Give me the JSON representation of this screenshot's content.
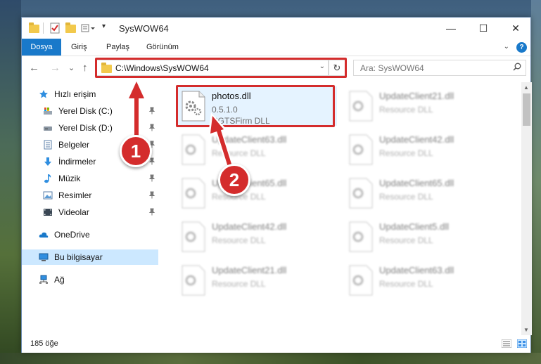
{
  "window": {
    "title": "SysWOW64",
    "minimize": "—",
    "maximize": "☐",
    "close": "✕"
  },
  "ribbon": {
    "tabs": [
      "Dosya",
      "Giriş",
      "Paylaş",
      "Görünüm"
    ],
    "active_tab": "Dosya",
    "help": "?"
  },
  "nav": {
    "back": "←",
    "forward": "→",
    "recent": "⌄",
    "up": "↑",
    "address": "C:\\Windows\\SysWOW64",
    "refresh": "↻"
  },
  "search": {
    "placeholder": "Ara: SysWOW64"
  },
  "sidebar": {
    "quick_access": "Hızlı erişim",
    "items": [
      {
        "label": "Yerel Disk (C:)",
        "icon": "drive-icon"
      },
      {
        "label": "Yerel Disk (D:)",
        "icon": "drive-icon"
      },
      {
        "label": "Belgeler",
        "icon": "documents-icon"
      },
      {
        "label": "İndirmeler",
        "icon": "download-icon"
      },
      {
        "label": "Müzik",
        "icon": "music-icon"
      },
      {
        "label": "Resimler",
        "icon": "pictures-icon"
      },
      {
        "label": "Videolar",
        "icon": "videos-icon"
      }
    ],
    "onedrive": "OneDrive",
    "this_pc": "Bu bilgisayar",
    "network": "Ağ"
  },
  "files": {
    "left": [
      {
        "name": "photos.dll",
        "line2": "0.5.1.0",
        "line3": "RGTSFirm DLL"
      },
      {
        "name": "UpdateClient63.dll",
        "line2": "Resource DLL",
        "line3": ""
      },
      {
        "name": "UpdateClient65.dll",
        "line2": "Resource DLL",
        "line3": ""
      },
      {
        "name": "UpdateClient42.dll",
        "line2": "Resource DLL",
        "line3": ""
      },
      {
        "name": "UpdateClient21.dll",
        "line2": "Resource DLL",
        "line3": ""
      }
    ],
    "right": [
      {
        "name": "UpdateClient21.dll",
        "line2": "Resource DLL"
      },
      {
        "name": "UpdateClient42.dll",
        "line2": "Resource DLL"
      },
      {
        "name": "UpdateClient65.dll",
        "line2": "Resource DLL"
      },
      {
        "name": "UpdateClient5.dll",
        "line2": "Resource DLL"
      },
      {
        "name": "UpdateClient63.dll",
        "line2": "Resource DLL"
      }
    ]
  },
  "status": {
    "count": "185 öğe"
  },
  "callouts": {
    "step1": "1",
    "step2": "2"
  },
  "colors": {
    "accent": "#1979ca",
    "highlight": "#d42c2c",
    "selection": "#cce8ff"
  }
}
